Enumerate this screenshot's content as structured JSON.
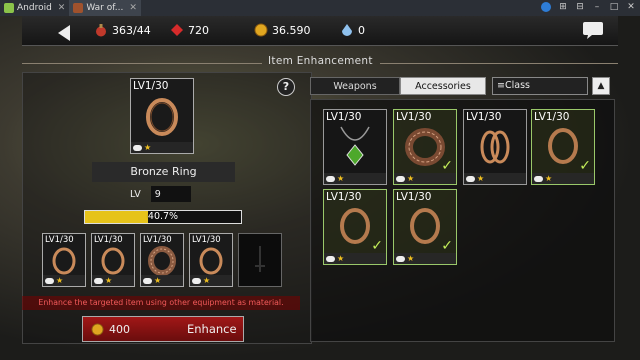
{
  "window": {
    "tabs": [
      {
        "label": "Android",
        "icon": "android-icon"
      },
      {
        "label": "War of...",
        "icon": "game-icon"
      }
    ]
  },
  "topbar": {
    "potion": "363/44",
    "ruby": "720",
    "gold": "36.590",
    "gem": "0"
  },
  "section_title": "Item Enhancement",
  "left": {
    "main_item": {
      "level": "LV1/30",
      "name": "Bronze Ring"
    },
    "level_label": "LV",
    "level_value": "9",
    "progress_text": "40.7%",
    "progress_value": 0.407,
    "materials": [
      {
        "level": "LV1/30",
        "type": "ring"
      },
      {
        "level": "LV1/30",
        "type": "ring"
      },
      {
        "level": "LV1/30",
        "type": "bracelet"
      },
      {
        "level": "LV1/30",
        "type": "ring"
      }
    ],
    "warning": "Enhance the targeted item using other equipment as material.",
    "cost": "400",
    "enhance_label": "Enhance"
  },
  "right": {
    "tabs": {
      "weapons": "Weapons",
      "accessories": "Accessories"
    },
    "class_label": "Class",
    "items": [
      {
        "level": "LV1/30",
        "type": "necklace",
        "selected": false,
        "checked": false
      },
      {
        "level": "LV1/30",
        "type": "bracelet",
        "selected": true,
        "checked": true
      },
      {
        "level": "LV1/30",
        "type": "double-ring",
        "selected": false,
        "checked": false
      },
      {
        "level": "LV1/30",
        "type": "ring",
        "selected": true,
        "checked": true
      },
      {
        "level": "LV1/30",
        "type": "ring",
        "selected": true,
        "checked": true
      },
      {
        "level": "LV1/30",
        "type": "ring",
        "selected": true,
        "checked": true
      }
    ]
  },
  "colors": {
    "accent_gold": "#e6c31a",
    "enhance_red": "#a11717",
    "check_green": "#c4ee5a"
  }
}
